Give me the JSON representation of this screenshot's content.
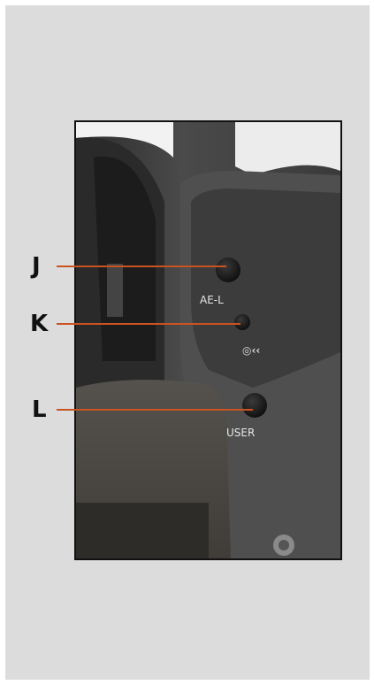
{
  "callouts": [
    {
      "letter": "J",
      "target": "AE-L button"
    },
    {
      "letter": "K",
      "target": "control dial / adjuster"
    },
    {
      "letter": "L",
      "target": "USER button"
    }
  ],
  "camera_labels": {
    "ael": "AE-L",
    "user": "USER"
  },
  "colors": {
    "leader": "#c9541f",
    "panel": "#dcdcdc"
  }
}
